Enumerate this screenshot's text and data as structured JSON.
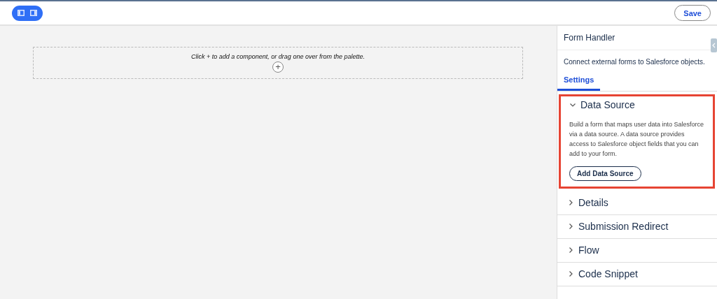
{
  "toolbar": {
    "save": "Save"
  },
  "canvas": {
    "hint": "Click + to add a component, or drag one over from the palette.",
    "add": "+"
  },
  "panel": {
    "title": "Form Handler",
    "description": "Connect external forms to Salesforce objects.",
    "tabs": [
      {
        "label": "Settings",
        "selected": true
      }
    ],
    "sections": [
      {
        "title": "Data Source",
        "expanded": true,
        "highlighted": true,
        "body": "Build a form that maps user data into Salesforce via a data source. A data source provides access to Salesforce object fields that you can add to your form.",
        "button": "Add Data Source"
      },
      {
        "title": "Details",
        "expanded": false,
        "highlighted": false
      },
      {
        "title": "Submission Redirect",
        "expanded": false,
        "highlighted": false
      },
      {
        "title": "Flow",
        "expanded": false,
        "highlighted": false
      },
      {
        "title": "Code Snippet",
        "expanded": false,
        "highlighted": false
      }
    ]
  }
}
